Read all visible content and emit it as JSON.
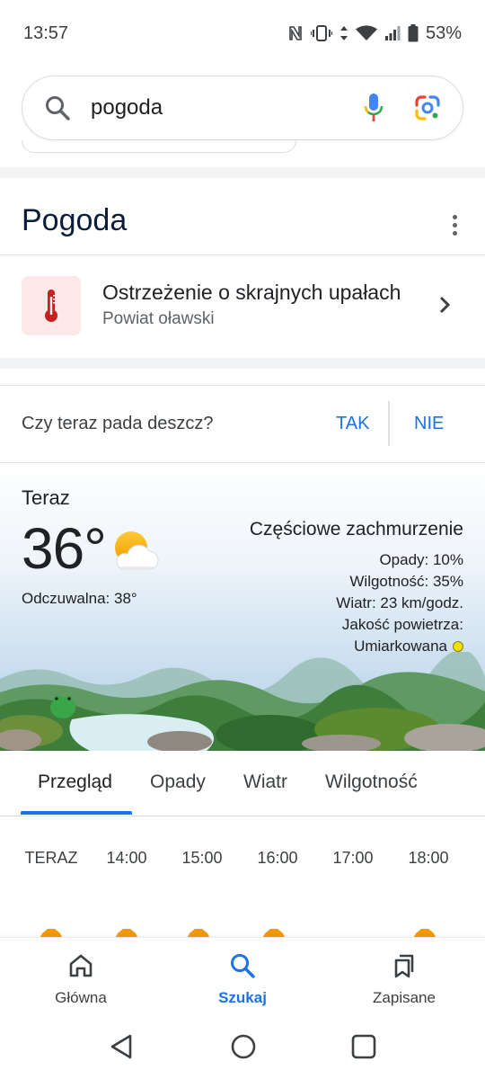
{
  "status_bar": {
    "time": "13:57",
    "battery": "53%"
  },
  "search": {
    "query": "pogoda"
  },
  "card": {
    "title": "Pogoda"
  },
  "alert": {
    "title": "Ostrzeżenie o skrajnych upałach",
    "subtitle": "Powiat oławski"
  },
  "rain_question": {
    "question": "Czy teraz pada deszcz?",
    "yes": "TAK",
    "no": "NIE"
  },
  "current": {
    "label": "Teraz",
    "temperature": "36°",
    "feels_like": "Odczuwalna: 38°",
    "condition": "Częściowe zachmurzenie",
    "precipitation": "Opady: 10%",
    "humidity": "Wilgotność: 35%",
    "wind": "Wiatr: 23 km/godz.",
    "air_quality_label": "Jakość powietrza:",
    "air_quality_value": "Umiarkowana",
    "air_quality_color": "#f2e200"
  },
  "tabs": [
    {
      "label": "Przegląd"
    },
    {
      "label": "Opady"
    },
    {
      "label": "Wiatr"
    },
    {
      "label": "Wilgotność"
    }
  ],
  "hourly": [
    {
      "time": "TERAZ",
      "icon": "partly-cloudy-icon"
    },
    {
      "time": "14:00",
      "icon": "partly-cloudy-icon"
    },
    {
      "time": "15:00",
      "icon": "partly-cloudy-icon"
    },
    {
      "time": "16:00",
      "icon": "partly-cloudy-icon"
    },
    {
      "time": "17:00",
      "icon": "cloudy-icon"
    },
    {
      "time": "18:00",
      "icon": "partly-cloudy-icon"
    }
  ],
  "bottom_nav": [
    {
      "label": "Główna",
      "icon": "home-icon"
    },
    {
      "label": "Szukaj",
      "icon": "search-icon"
    },
    {
      "label": "Zapisane",
      "icon": "bookmarks-icon"
    }
  ],
  "colors": {
    "accent": "#1a73e8",
    "alert_bg": "#fce8e6",
    "alert_icon": "#c5221f"
  }
}
